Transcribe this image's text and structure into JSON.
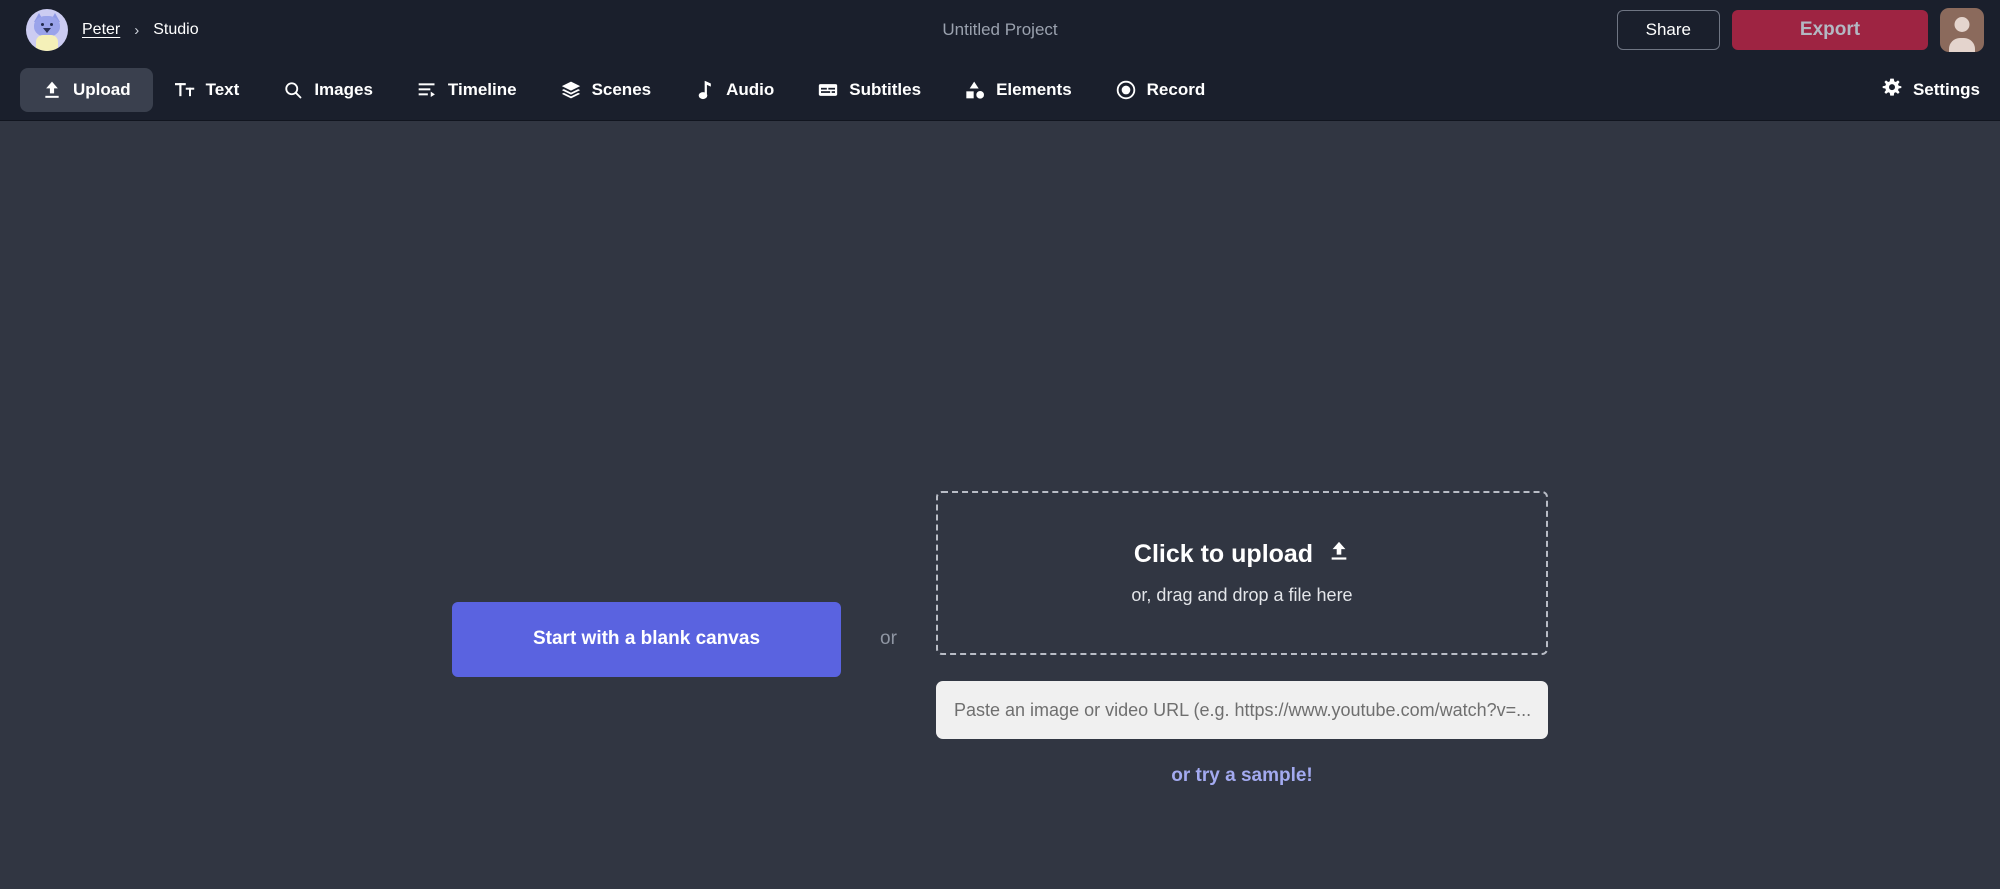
{
  "header": {
    "brand": {
      "avatar_icon": "cat-avatar",
      "user_name": "Peter",
      "separator": "›",
      "section": "Studio"
    },
    "project_title": "Untitled Project",
    "actions": {
      "share_label": "Share",
      "export_label": "Export",
      "user_avatar_icon": "user-avatar"
    },
    "tabs": [
      {
        "label": "Upload",
        "icon": "upload-icon",
        "active": true
      },
      {
        "label": "Text",
        "icon": "text-icon",
        "active": false
      },
      {
        "label": "Images",
        "icon": "search-icon",
        "active": false
      },
      {
        "label": "Timeline",
        "icon": "timeline-icon",
        "active": false
      },
      {
        "label": "Scenes",
        "icon": "layers-icon",
        "active": false
      },
      {
        "label": "Audio",
        "icon": "music-note-icon",
        "active": false
      },
      {
        "label": "Subtitles",
        "icon": "subtitles-icon",
        "active": false
      },
      {
        "label": "Elements",
        "icon": "shapes-icon",
        "active": false
      },
      {
        "label": "Record",
        "icon": "record-icon",
        "active": false
      }
    ],
    "settings_label": "Settings",
    "settings_icon": "gear-icon"
  },
  "main": {
    "blank_canvas_label": "Start with a blank canvas",
    "or_label": "or",
    "dropzone": {
      "title": "Click to upload",
      "icon": "upload-icon",
      "subtitle": "or, drag and drop a file here"
    },
    "url_field": {
      "placeholder": "Paste an image or video URL (e.g. https://www.youtube.com/watch?v=...)",
      "value": ""
    },
    "sample_link_label": "or try a sample!"
  },
  "colors": {
    "header_bg": "#1a1f2c",
    "canvas_bg": "#313642",
    "tab_active_bg": "#3a404e",
    "export_bg": "#9e2442",
    "blank_canvas_bg": "#5a63e0",
    "sample_link": "#a3aaf0",
    "url_field_bg": "#f0f0f0",
    "dropzone_border": "#b9bdc6"
  }
}
